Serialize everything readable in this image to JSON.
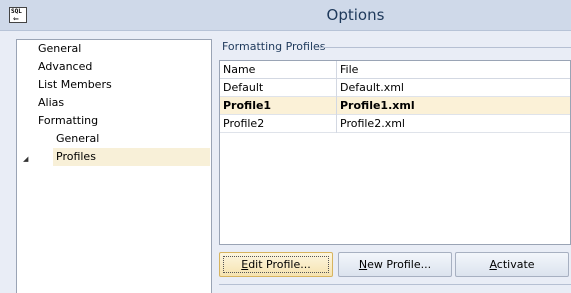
{
  "window": {
    "title": "Options",
    "icon": "sql-app-icon",
    "icon_text": "SQL"
  },
  "tree": {
    "items": [
      {
        "label": "General",
        "level": 0
      },
      {
        "label": "Advanced",
        "level": 0
      },
      {
        "label": "List Members",
        "level": 0
      },
      {
        "label": "Alias",
        "level": 0
      },
      {
        "label": "Formatting",
        "level": 0,
        "expanded": true
      },
      {
        "label": "General",
        "level": 1
      },
      {
        "label": "Profiles",
        "level": 1,
        "selected": true
      }
    ]
  },
  "profiles": {
    "group_label": "Formatting Profiles",
    "columns": [
      "Name",
      "File"
    ],
    "rows": [
      {
        "name": "Default",
        "file": "Default.xml",
        "selected": false
      },
      {
        "name": "Profile1",
        "file": "Profile1.xml",
        "selected": true
      },
      {
        "name": "Profile2",
        "file": "Profile2.xml",
        "selected": false
      }
    ]
  },
  "buttons": {
    "edit": {
      "mnemonic": "E",
      "rest": "dit Profile..."
    },
    "new": {
      "mnemonic": "N",
      "rest": "ew Profile..."
    },
    "activate": {
      "mnemonic": "A",
      "rest": "ctivate"
    }
  },
  "colors": {
    "selection": "#f8f0d8",
    "title_text": "#1e395b",
    "focused_button": "#f6e3b0"
  }
}
